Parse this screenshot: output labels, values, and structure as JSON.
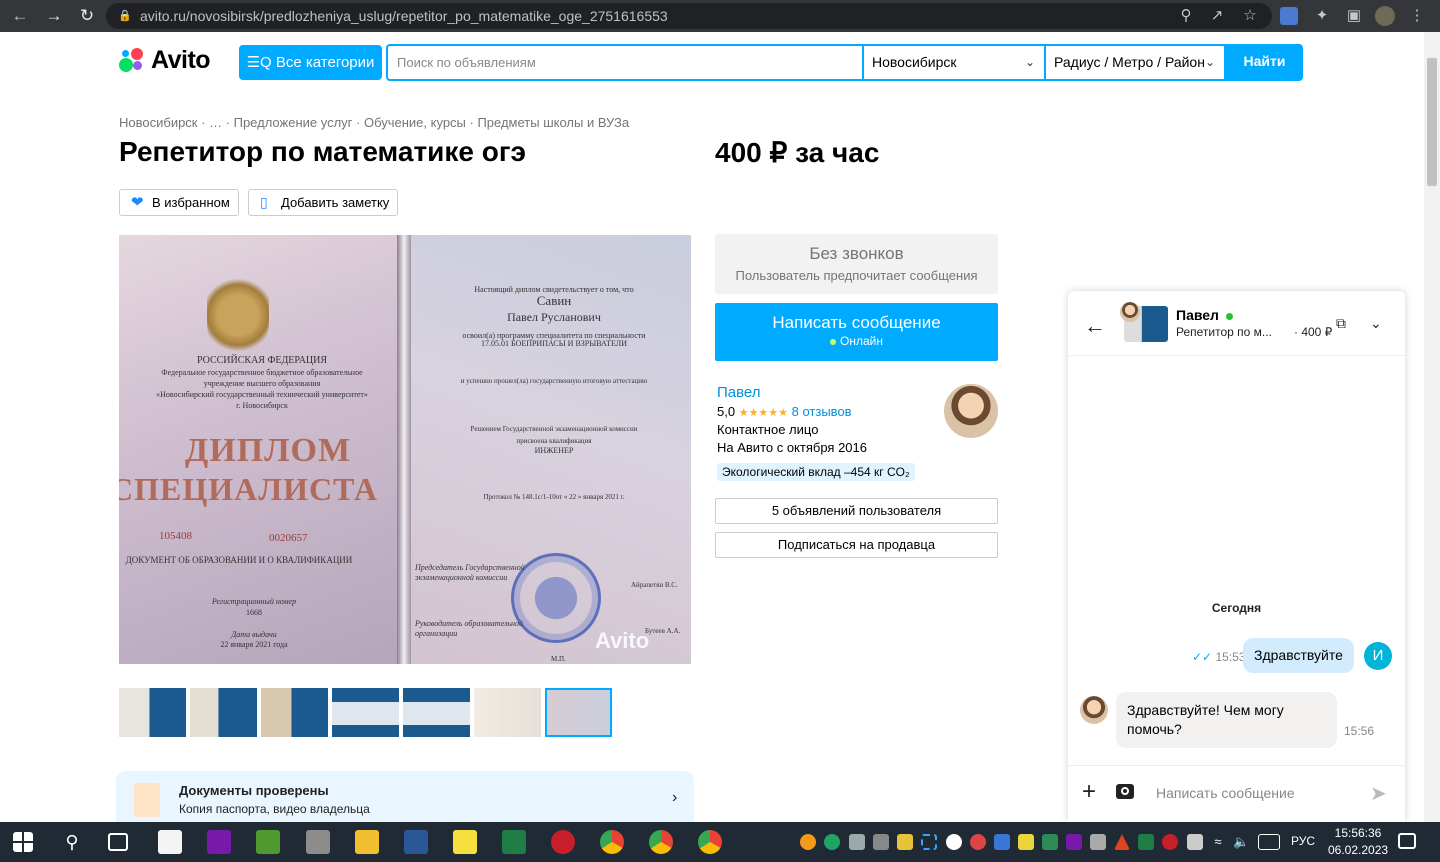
{
  "browser": {
    "url": "avito.ru/novosibirsk/predlozheniya_uslug/repetitor_po_matematike_oge_2751616553"
  },
  "header": {
    "logo_text": "Avito",
    "categories_label": "☰Q Все категории",
    "search_placeholder": "Поиск по объявлениям",
    "city": "Новосибирск",
    "radius": "Радиус / Метро / Район",
    "find_label": "Найти"
  },
  "breadcrumb": "Новосибирск · … · Предложение услуг · Обучение, курсы · Предметы школы и ВУЗа",
  "listing": {
    "title": "Репетитор по математике огэ",
    "price": "400 ₽ за час",
    "favorite_label": "В избранном",
    "note_label": "Добавить заметку"
  },
  "photo_text": {
    "left_country": "РОССИЙСКАЯ ФЕДЕРАЦИЯ",
    "left_org1": "Федеральное государственное бюджетное образовательное",
    "left_org2": "учреждение высшего образования",
    "left_org3": "«Новосибирский государственный технический университет»",
    "left_city": "г. Новосибирск",
    "left_big1": "ДИПЛОМ",
    "left_big2": "СПЕЦИАЛИСТА",
    "left_series": "105408",
    "left_number": "0020657",
    "left_doc": "ДОКУМЕНТ ОБ ОБРАЗОВАНИИ И О КВАЛИФИКАЦИИ",
    "left_reg_label": "Регистрационный номер",
    "left_reg_no": "1668",
    "left_issue_label": "Дата выдачи",
    "left_issue_date": "22 января 2021 года",
    "right_intro": "Настоящий диплом свидетельствует о том, что",
    "right_surname": "Савин",
    "right_name": "Павел Русланович",
    "right_program": "освоил(а) программу специалитета по специальности",
    "right_spec": "17.05.01 БОЕПРИПАСЫ И ВЗРЫВАТЕЛИ",
    "right_exam": "и успешно прошел(ла) государственную итоговую аттестацию",
    "right_decision": "Решением Государственной экзаменационной комиссии",
    "right_assigned": "присвоена квалификация",
    "right_qual": "ИНЖЕНЕР",
    "right_protocol": "Протокол № 148.1с/1-10от « 22 » января 2021 г.",
    "right_chair": "Председатель Государственной экзаменационной комиссии",
    "right_chair_name": "Айрапетян В.С.",
    "right_head": "Руководитель образовательной организации",
    "right_head_name": "Бутеев А.А.",
    "right_mp": "М.П.",
    "watermark": "Avito"
  },
  "seller": {
    "no_calls_title": "Без звонков",
    "no_calls_sub": "Пользователь предпочитает сообщения",
    "write_label": "Написать сообщение",
    "online_label": "Онлайн",
    "name": "Павел",
    "rating": "5,0",
    "reviews_label": "8 отзывов",
    "type": "Контактное лицо",
    "since": "На Авито с октября 2016",
    "eco_label": "Экологический вклад –454 кг CO₂",
    "listings_btn": "5 объявлений пользователя",
    "subscribe_btn": "Подписаться на продавца"
  },
  "docs": {
    "title": "Документы проверены",
    "subtitle": "Копия паспорта, видео владельца"
  },
  "chat": {
    "peer_name": "Павел",
    "subject": "Репетитор по м...",
    "price": "· 400 ₽",
    "day_label": "Сегодня",
    "out_message": "Здравствуйте",
    "out_time": "15:53",
    "my_initial": "И",
    "in_message": "Здравствуйте! Чем могу помочь?",
    "in_time": "15:56",
    "input_placeholder": "Написать сообщение"
  },
  "taskbar": {
    "lang": "РУС",
    "time": "15:56:36",
    "date": "06.02.2023"
  },
  "colors": {
    "accent": "#00aaff",
    "link": "#0091d9",
    "star": "#ffb021",
    "online": "#23c12a"
  }
}
